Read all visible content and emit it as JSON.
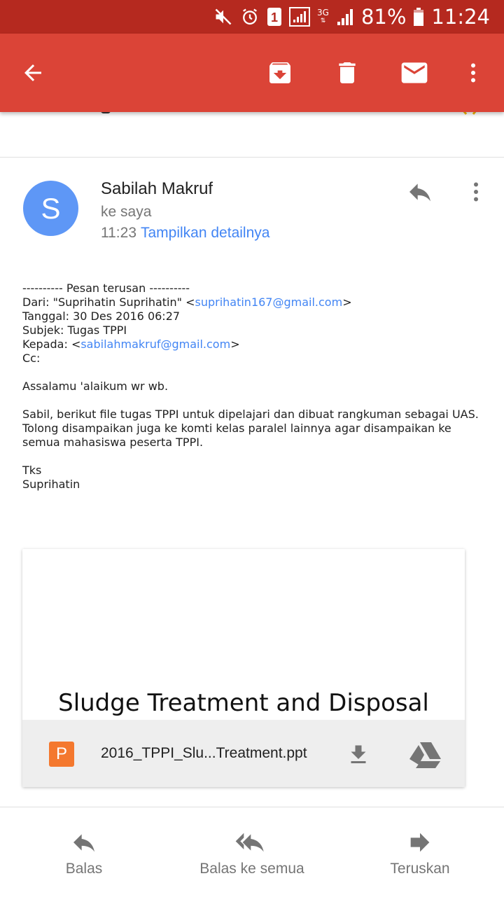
{
  "status_bar": {
    "battery": "81%",
    "time": "11:24",
    "sim_slot": "1",
    "network": "3G",
    "icons": [
      "mute-icon",
      "alarm-icon",
      "sim-1-icon",
      "signal-icon",
      "network-3g-icon",
      "signal-icon",
      "battery-icon"
    ]
  },
  "toolbar": {
    "color": "#db4437",
    "icons": [
      "back-arrow-icon",
      "archive-icon",
      "delete-icon",
      "mark-unread-icon",
      "more-vert-icon"
    ]
  },
  "message": {
    "avatar_letter": "S",
    "avatar_color": "#5e97f6",
    "sender": "Sabilah Makruf",
    "recipient": "ke saya",
    "time": "11:23",
    "details_link": "Tampilkan detailnya"
  },
  "body": {
    "forward_header": "---------- Pesan terusan ----------",
    "from_label": "Dari: \"Suprihatin Suprihatin\" <",
    "from_email": "suprihatin167@gmail.com",
    "from_end": ">",
    "date": "Tanggal: 30 Des 2016 06:27",
    "subject": "Subjek: Tugas TPPI",
    "to_label": "Kepada: <",
    "to_email": "sabilahmakruf@gmail.com",
    "to_end": ">",
    "cc": "Cc:",
    "greeting": "Assalamu 'alaikum wr wb.",
    "para1_line1": "Sabil, berikut file tugas TPPI untuk dipelajari dan dibuat rangkuman sebagai UAS.",
    "para1_line2": "Tolong disampaikan juga ke komti kelas paralel lainnya agar disampaikan ke",
    "para1_line3": "semua mahasiswa peserta TPPI.",
    "closing": "Tks",
    "signature": "Suprihatin"
  },
  "attachment": {
    "preview_title": "Sludge Treatment and Disposal",
    "type_letter": "P",
    "type_color": "#f4782e",
    "filename": "2016_TPPI_Slu...Treatment.ppt"
  },
  "actions": {
    "reply": "Balas",
    "reply_all": "Balas ke semua",
    "forward": "Teruskan"
  }
}
